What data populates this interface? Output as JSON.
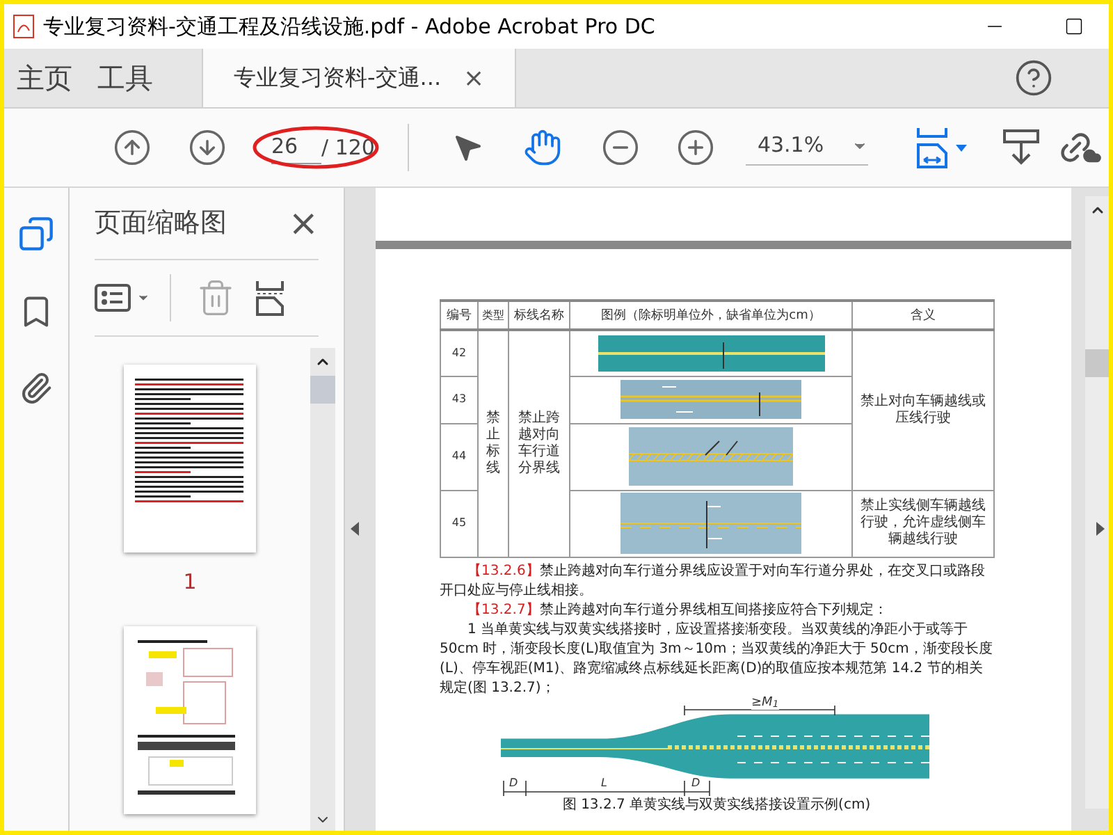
{
  "window": {
    "title": "专业复习资料-交通工程及沿线设施.pdf - Adobe Acrobat Pro DC"
  },
  "nav_tabs": [
    {
      "label": "主页",
      "selected": false
    },
    {
      "label": "工具",
      "selected": false
    },
    {
      "label": "专业复习资料-交通...",
      "selected": true,
      "close": "×"
    }
  ],
  "toolbar": {
    "page_number": "26",
    "page_total": "/ 120",
    "zoom": "43.1%",
    "hand_tool_active": true
  },
  "sidebar": {
    "title": "页面缩略图",
    "close": "×",
    "thumbnails": [
      {
        "kind": "text",
        "label": "1"
      },
      {
        "kind": "diagram"
      }
    ]
  },
  "page": {
    "table": {
      "columns": [
        "编号",
        "类型",
        "标线名称",
        "图例（除标明单位外，缺省单位为cm）",
        "含义"
      ],
      "type": "禁止标线",
      "name": "禁止跨越对向车行道分界线",
      "groups": [
        {
          "meaning": "禁止对向车辆越线或压线行驶",
          "rows": [
            {
              "number": "42",
              "kind": "single"
            },
            {
              "number": "43",
              "kind": "double"
            },
            {
              "number": "44",
              "kind": "hatched"
            }
          ]
        },
        {
          "meaning": "禁止实线侧车辆越线行驶，允许虚线侧车辆越线行驶",
          "rows": [
            {
              "number": "45",
              "kind": "mixed"
            }
          ]
        }
      ]
    },
    "paragraphs": [
      {
        "ref": "【13.2.6】",
        "text": "禁止跨越对向车行道分界线应设置于对向车行道分界处，在交叉口或路段开口处应与停止线相接。"
      },
      {
        "ref": "【13.2.7】",
        "text": "禁止跨越对向车行道分界线相互间搭接应符合下列规定："
      },
      {
        "text": "1 当单黄实线与双黄实线搭接时，应设置搭接渐变段。当双黄线的净距小于或等于 50cm 时，渐变段长度(L)取值宜为 3m～10m；当双黄线的净距大于 50cm，渐变段长度(L)、停车视距(M1)、路宽缩减终点标线延长距离(D)的取值应按本规范第 14.2 节的相关规定(图 13.2.7)；"
      }
    ],
    "figure": {
      "sight_label": "≥M$_{1}$",
      "labels": [
        "D",
        "L",
        "D"
      ],
      "caption": "图 13.2.7 单黄实线与双黄实线搭接设置示例(cm)"
    }
  }
}
